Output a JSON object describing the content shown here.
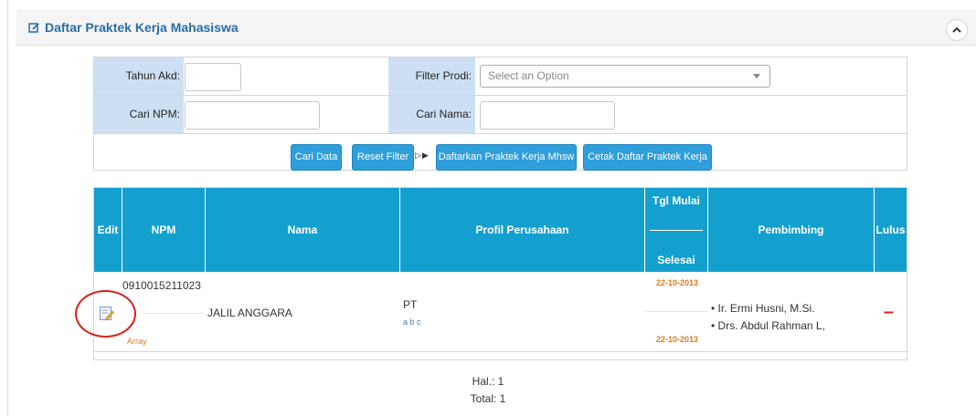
{
  "header": {
    "title": "Daftar Praktek Kerja Mahasiswa",
    "title_icon": "edit-square-icon",
    "collapse_icon": "chevron-up-icon"
  },
  "filters": {
    "tahun_label": "Tahun Akd:",
    "tahun_value": "",
    "prodi_label": "Filter Prodi:",
    "prodi_selected": "Select an Option",
    "npm_label": "Cari NPM:",
    "npm_value": "",
    "nama_label": "Cari Nama:",
    "nama_value": ""
  },
  "buttons": {
    "cari": "Cari Data",
    "reset": "Reset Filter",
    "separator": "▷▶",
    "daftarkan": "Daftarkan Praktek Kerja Mhsw",
    "cetak": "Cetak Daftar Praktek Kerja"
  },
  "table": {
    "headers": {
      "edit": "Edit",
      "npm": "NPM",
      "nama": "Nama",
      "profil": "Profil Perusahaan",
      "tgl_mulai": "Tgl Mulai",
      "selesai": "Selesai",
      "pembimbing": "Pembimbing",
      "lulus": "Lulus"
    },
    "rows": [
      {
        "npm": "0910015211023",
        "npm_sub": "Array",
        "nama": "JALIL ANGGARA",
        "perusahaan": "PT",
        "perusahaan_sub": "a b c",
        "tgl_mulai": "22-10-2013",
        "tgl_selesai": "22-10-2013",
        "pembimbing": [
          "• Ir. Ermi Husni, M.Si.",
          "• Drs. Abdul Rahman L,"
        ],
        "lulus": "–"
      }
    ]
  },
  "pagination": {
    "hal": "Hal.: 1",
    "total": "Total: 1"
  },
  "colors": {
    "accent": "#14a0cf",
    "button": "#2e9fdb",
    "label_bg": "#cde0f3",
    "date_orange": "#e07a1a",
    "lulus_red": "#d9211e"
  }
}
